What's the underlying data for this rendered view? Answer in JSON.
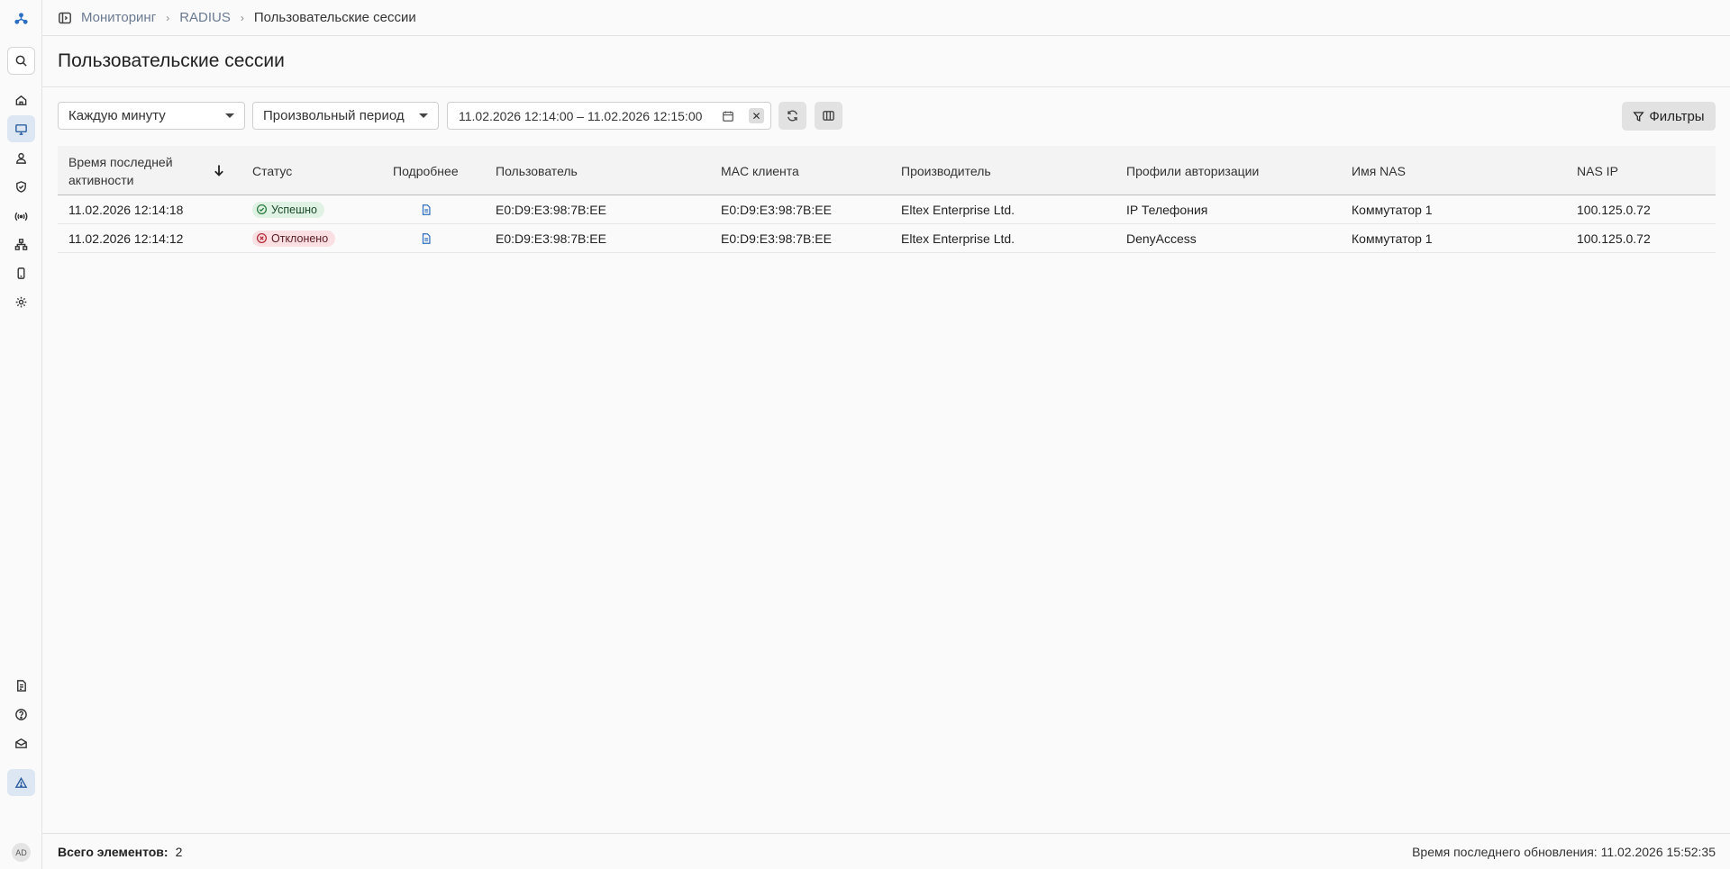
{
  "breadcrumb": {
    "items": [
      "Мониторинг",
      "RADIUS",
      "Пользовательские сессии"
    ]
  },
  "page": {
    "title": "Пользовательские сессии"
  },
  "toolbar": {
    "refresh_interval": "Каждую минуту",
    "period": "Произвольный период",
    "date_range": "11.02.2026 12:14:00 – 11.02.2026 12:15:00",
    "filters_label": "Фильтры"
  },
  "table": {
    "columns": [
      "Время последней активности",
      "Статус",
      "Подробнее",
      "Пользователь",
      "MAC клиента",
      "Производитель",
      "Профили авторизации",
      "Имя NAS",
      "NAS IP"
    ],
    "rows": [
      {
        "time": "11.02.2026 12:14:18",
        "status": "Успешно",
        "status_kind": "success",
        "user": "E0:D9:E3:98:7B:EE",
        "mac": "E0:D9:E3:98:7B:EE",
        "vendor": "Eltex Enterprise Ltd.",
        "profile": "IP Телефония",
        "nas_name": "Коммутатор 1",
        "nas_ip": "100.125.0.72"
      },
      {
        "time": "11.02.2026 12:14:12",
        "status": "Отклонено",
        "status_kind": "rejected",
        "user": "E0:D9:E3:98:7B:EE",
        "mac": "E0:D9:E3:98:7B:EE",
        "vendor": "Eltex Enterprise Ltd.",
        "profile": "DenyAccess",
        "nas_name": "Коммутатор 1",
        "nas_ip": "100.125.0.72"
      }
    ]
  },
  "footer": {
    "total_label": "Всего элементов:",
    "total_value": "2",
    "updated": "Время последнего обновления: 11.02.2026 15:52:35"
  },
  "user": {
    "initials": "AD"
  },
  "colors": {
    "accent": "#2d5fa0",
    "success_bg": "#dff2e4",
    "rejected_bg": "#fbe0e3"
  }
}
